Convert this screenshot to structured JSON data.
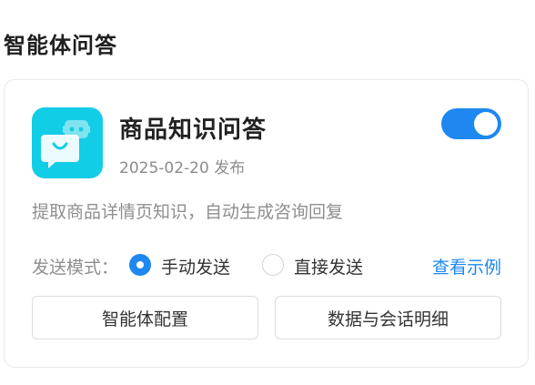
{
  "section": {
    "title": "智能体问答"
  },
  "agent": {
    "title": "商品知识问答",
    "date": "2025-02-20 发布",
    "description": "提取商品详情页知识，自动生成咨询回复",
    "icon": "shopping-bag-robot-icon",
    "enabled": true
  },
  "send_mode": {
    "label": "发送模式：",
    "options": [
      {
        "label": "手动发送",
        "selected": true
      },
      {
        "label": "直接发送",
        "selected": false
      }
    ],
    "example_link": "查看示例"
  },
  "buttons": {
    "config": "智能体配置",
    "stats": "数据与会话明细"
  },
  "colors": {
    "accent": "#1e88f0",
    "icon_bg": "#12cde6"
  }
}
